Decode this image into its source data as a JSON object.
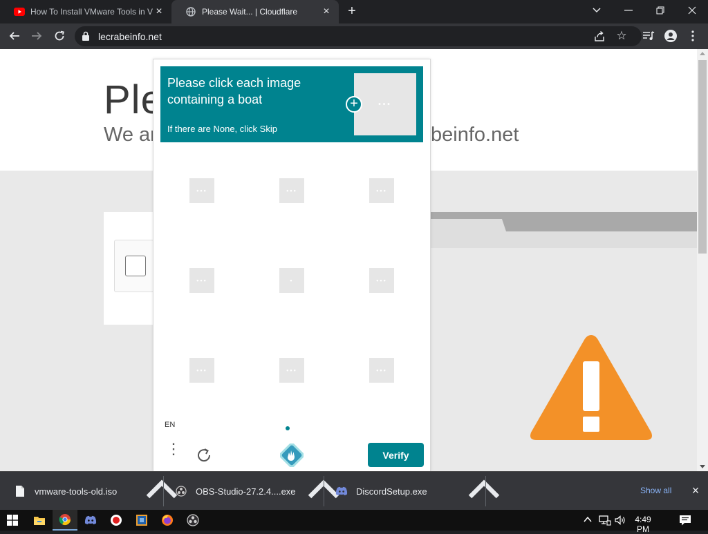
{
  "browser": {
    "tabs": [
      {
        "label": "How To Install VMware Tools in V",
        "favicon": "youtube-icon",
        "active": false
      },
      {
        "label": "Please Wait... | Cloudflare",
        "favicon": "globe-icon",
        "active": true
      }
    ],
    "url": "lecrabeinfo.net"
  },
  "page": {
    "title_partial": "Ple",
    "subtitle_left": "We ar",
    "subtitle_right": "beinfo.net"
  },
  "captcha": {
    "prompt_title": "Please click each image containing a boat",
    "prompt_sub": "If there are None, click Skip",
    "tile_count": 9,
    "language": "EN",
    "verify_label": "Verify",
    "accent_color": "#00838f"
  },
  "downloads": {
    "items": [
      {
        "name": "vmware-tools-old.iso",
        "icon": "file-icon"
      },
      {
        "name": "OBS-Studio-27.2.4....exe",
        "icon": "obs-icon"
      },
      {
        "name": "DiscordSetup.exe",
        "icon": "discord-icon"
      }
    ],
    "show_all": "Show all"
  },
  "taskbar": {
    "clock": "4:49 PM",
    "apps": [
      "start-icon",
      "file-explorer-icon",
      "chrome-icon",
      "discord-icon",
      "record-icon",
      "virtualbox-icon",
      "firefox-icon",
      "obs-icon"
    ]
  },
  "colors": {
    "warning": "#f39128",
    "browser_dark": "#202124",
    "toolbar": "#35363a"
  }
}
